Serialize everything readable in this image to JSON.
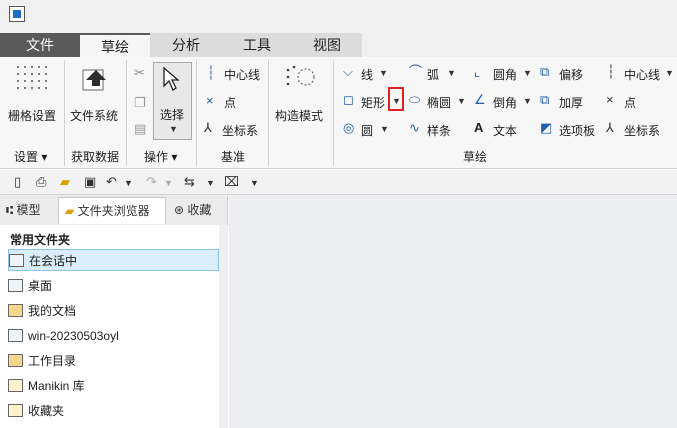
{
  "tabs": [
    "文件",
    "草绘",
    "分析",
    "工具",
    "视图"
  ],
  "ribbon": {
    "grid_settings": "栅格设置",
    "file_system": "文件系统",
    "select": "选择",
    "centerline": "中心线",
    "point": "点",
    "csys": "坐标系",
    "construction_mode": "构造模式",
    "line": "线",
    "arc": "弧",
    "fillet": "圆角",
    "offset": "偏移",
    "centerline2": "中心线",
    "rectangle": "矩形",
    "ellipse": "椭圆",
    "chamfer": "倒角",
    "thicken": "加厚",
    "point2": "点",
    "circle": "圆",
    "spline": "样条",
    "text": "文本",
    "palette": "选项板",
    "csys2": "坐标系"
  },
  "groups": {
    "settings": "设置",
    "get_data": "获取数据",
    "operations": "操作",
    "datum": "基准",
    "sketch": "草绘"
  },
  "navigator": {
    "tabs": [
      "模型",
      "文件夹浏览器",
      "收藏"
    ],
    "section_title": "常用文件夹",
    "folders": [
      "在会话中",
      "桌面",
      "我的文档",
      "win-20230503oyl",
      "工作目录",
      "Manikin 库",
      "收藏夹"
    ]
  },
  "icons": {
    "grid": "grid-icon",
    "filesystem": "file-system-icon",
    "selection": "pointer-icon",
    "save": "save-icon",
    "undo": "undo-icon",
    "redo": "redo-icon"
  },
  "colors": {
    "accent": "#1f5fb0",
    "highlight_box": "#e02020",
    "selected_row": "#d9eefa"
  }
}
